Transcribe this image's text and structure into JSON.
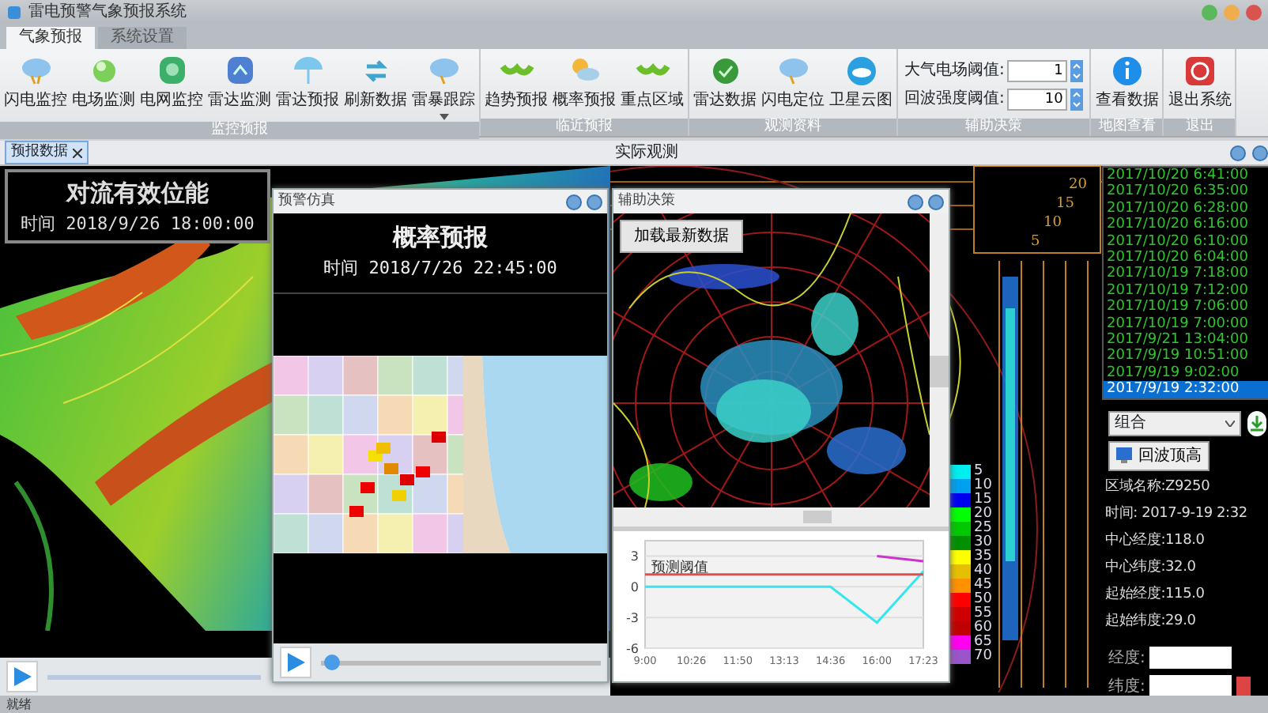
{
  "window": {
    "title": "雷电预警气象预报系统"
  },
  "ribbon_tabs": [
    {
      "label": "气象预报",
      "selected": true
    },
    {
      "label": "系统设置",
      "selected": false
    }
  ],
  "ribbon_groups": [
    {
      "label": "监控预报",
      "kind": "buttons",
      "buttons": [
        {
          "label": "闪电监控"
        },
        {
          "label": "电场监测"
        },
        {
          "label": "电网监控"
        },
        {
          "label": "雷达监测"
        },
        {
          "label": "雷达预报"
        },
        {
          "label": "刷新数据"
        },
        {
          "label": "雷暴跟踪",
          "dropdown": true
        }
      ]
    },
    {
      "label": "临近预报",
      "kind": "buttons",
      "buttons": [
        {
          "label": "趋势预报"
        },
        {
          "label": "概率预报"
        },
        {
          "label": "重点区域"
        }
      ]
    },
    {
      "label": "观测资料",
      "kind": "buttons",
      "buttons": [
        {
          "label": "雷达数据"
        },
        {
          "label": "闪电定位"
        },
        {
          "label": "卫星云图"
        }
      ]
    },
    {
      "label": "辅助决策",
      "kind": "fields",
      "fields": [
        {
          "label": "大气电场阈值:",
          "value": "1"
        },
        {
          "label": "回波强度阈值:",
          "value": "10"
        }
      ]
    },
    {
      "label": "地图查看",
      "kind": "buttons",
      "buttons": [
        {
          "label": "查看数据"
        }
      ]
    },
    {
      "label": "退出",
      "kind": "buttons",
      "buttons": [
        {
          "label": "退出系统"
        }
      ]
    }
  ],
  "left_pane": {
    "tab": "预报数据",
    "map_title": "对流有效位能",
    "map_time": "时间 2018/9/26 18:00:00"
  },
  "warning_window": {
    "title": "预警仿真",
    "heading": "概率预报",
    "time": "时间 2018/7/26 22:45:00",
    "slider": {
      "level": 0.04
    }
  },
  "decision_window": {
    "title": "辅助决策",
    "load_button": "加载最新数据",
    "chart_data": {
      "type": "line",
      "categories": [
        "9:00",
        "10:26",
        "11:50",
        "13:13",
        "14:36",
        "16:00",
        "17:23"
      ],
      "yticks": [
        3,
        0,
        -3,
        -6
      ],
      "ylim": [
        -6,
        4.5
      ],
      "grid": true,
      "series": [
        {
          "color": "#33e6f0",
          "values": [
            0,
            0,
            0,
            0,
            0,
            -3.5,
            1.5
          ]
        },
        {
          "color": "#cc33cc",
          "values": [
            null,
            null,
            null,
            null,
            null,
            3,
            2.5
          ]
        },
        {
          "name": "预测阈值",
          "color": "#e05050",
          "values": [
            1.2,
            1.2,
            1.2,
            1.2,
            1.2,
            1.2,
            1.2
          ]
        }
      ]
    }
  },
  "right_pane": {
    "title": "实际观测",
    "height_scale": [
      "20",
      "15",
      "10",
      "5"
    ],
    "legend": [
      {
        "label": "5",
        "color": "#00eeee"
      },
      {
        "label": "10",
        "color": "#00a0f0"
      },
      {
        "label": "15",
        "color": "#0000f0"
      },
      {
        "label": "20",
        "color": "#00ff00"
      },
      {
        "label": "25",
        "color": "#00c800"
      },
      {
        "label": "30",
        "color": "#009000"
      },
      {
        "label": "35",
        "color": "#ffff00"
      },
      {
        "label": "40",
        "color": "#e6c000"
      },
      {
        "label": "45",
        "color": "#ff9000"
      },
      {
        "label": "50",
        "color": "#ff0000"
      },
      {
        "label": "55",
        "color": "#d00000"
      },
      {
        "label": "60",
        "color": "#c00000"
      },
      {
        "label": "65",
        "color": "#ff00f0"
      },
      {
        "label": "70",
        "color": "#9955c9"
      }
    ],
    "times": [
      {
        "label": "2017/10/20 6:41:00",
        "selected": false
      },
      {
        "label": "2017/10/20 6:35:00",
        "selected": false
      },
      {
        "label": "2017/10/20 6:28:00",
        "selected": false
      },
      {
        "label": "2017/10/20 6:16:00",
        "selected": false
      },
      {
        "label": "2017/10/20 6:10:00",
        "selected": false
      },
      {
        "label": "2017/10/20 6:04:00",
        "selected": false
      },
      {
        "label": "2017/10/19 7:18:00",
        "selected": false
      },
      {
        "label": "2017/10/19 7:12:00",
        "selected": false
      },
      {
        "label": "2017/10/19 7:06:00",
        "selected": false
      },
      {
        "label": "2017/10/19 7:00:00",
        "selected": false
      },
      {
        "label": "2017/9/21 13:04:00",
        "selected": false
      },
      {
        "label": "2017/9/19 10:51:00",
        "selected": false
      },
      {
        "label": "2017/9/19 9:02:00",
        "selected": false
      },
      {
        "label": "2017/9/19 2:32:00",
        "selected": true
      }
    ],
    "product": "组合",
    "echo_button": "回波顶高",
    "info": [
      "区域名称:Z9250",
      "时间: 2017-9-19 2:32",
      "中心经度:118.0",
      "中心纬度:32.0",
      "起始经度:115.0",
      "起始纬度:29.0"
    ],
    "fields": [
      {
        "label": "经度:"
      },
      {
        "label": "纬度:"
      }
    ]
  },
  "status_bar": "就绪"
}
